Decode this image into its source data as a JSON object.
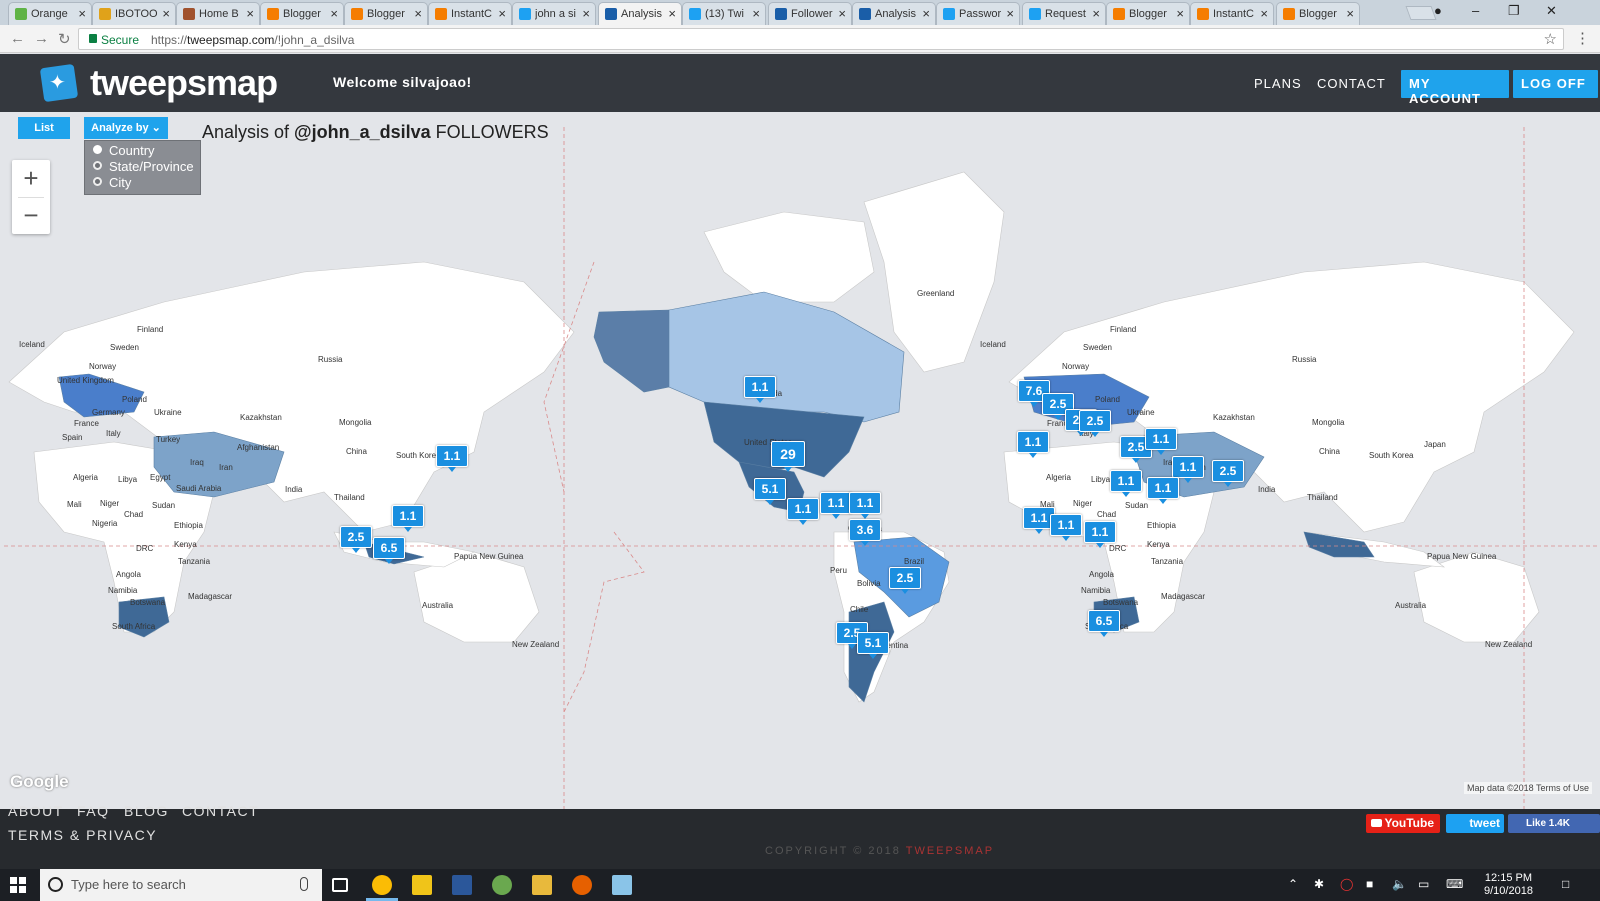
{
  "browser": {
    "tabs": [
      {
        "title": "Orange",
        "color": "#5fb346"
      },
      {
        "title": "IBOTOO",
        "color": "#e0a21a"
      },
      {
        "title": "Home B",
        "color": "#a0522d"
      },
      {
        "title": "Blogger",
        "color": "#f57d00"
      },
      {
        "title": "Blogger",
        "color": "#f57d00"
      },
      {
        "title": "InstantC",
        "color": "#f57d00"
      },
      {
        "title": "john a si",
        "color": "#1da1f2"
      },
      {
        "title": "Analysis",
        "color": "#1a5ea8",
        "active": true
      },
      {
        "title": "(13) Twi",
        "color": "#1da1f2"
      },
      {
        "title": "Follower",
        "color": "#1a5ea8"
      },
      {
        "title": "Analysis",
        "color": "#1a5ea8"
      },
      {
        "title": "Passwor",
        "color": "#1da1f2"
      },
      {
        "title": "Request",
        "color": "#1da1f2"
      },
      {
        "title": "Blogger",
        "color": "#f57d00"
      },
      {
        "title": "InstantC",
        "color": "#f57d00"
      },
      {
        "title": "Blogger",
        "color": "#f57d00"
      }
    ],
    "secure_label": "Secure",
    "url_scheme": "https://",
    "url_host": "tweepsmap.com",
    "url_path": "/!john_a_dsilva"
  },
  "site": {
    "logo_text": "tweepsmap",
    "welcome": "Welcome silvajoao!",
    "nav": {
      "plans": "PLANS",
      "contact": "CONTACT",
      "my_account": "MY ACCOUNT",
      "log_off": "LOG OFF"
    }
  },
  "controls": {
    "list_label": "List",
    "analyze_label": "Analyze by",
    "options": [
      "Country",
      "State/Province",
      "City"
    ],
    "selected": "Country",
    "title_prefix": "Analysis of ",
    "title_handle": "@john_a_dsilva",
    "title_suffix": " FOLLOWERS"
  },
  "map": {
    "google_label": "Google",
    "attribution": "Map data ©2018   Terms of Use",
    "place_labels": [
      "Iceland",
      "Finland",
      "Sweden",
      "Norway",
      "Russia",
      "United Kingdom",
      "Poland",
      "Germany",
      "Ukraine",
      "Kazakhstan",
      "France",
      "Italy",
      "Spain",
      "Mongolia",
      "Turkey",
      "Afghanistan",
      "China",
      "South Korea",
      "Iran",
      "Iraq",
      "Algeria",
      "Libya",
      "Egypt",
      "Saudi Arabia",
      "India",
      "Mali",
      "Niger",
      "Sudan",
      "Chad",
      "Thailand",
      "Nigeria",
      "Ethiopia",
      "DRC",
      "Kenya",
      "Tanzania",
      "Angola",
      "Namibia",
      "Madagascar",
      "Botswana",
      "South Africa",
      "Papua New Guinea",
      "Australia",
      "New Zealand",
      "Greenland",
      "Canada",
      "United States",
      "Colombia",
      "Peru",
      "Bolivia",
      "Chile",
      "Argentina",
      "Brazil",
      "Japan"
    ],
    "markers": [
      {
        "value": "1.1",
        "region": "Canada"
      },
      {
        "value": "29",
        "region": "United States"
      },
      {
        "value": "5.1",
        "region": "Mexico"
      },
      {
        "value": "1.1",
        "region": "Central America"
      },
      {
        "value": "1.1",
        "region": "Caribbean"
      },
      {
        "value": "1.1",
        "region": "Venezuela"
      },
      {
        "value": "3.6",
        "region": "Colombia"
      },
      {
        "value": "2.5",
        "region": "Brazil"
      },
      {
        "value": "2.5",
        "region": "Chile"
      },
      {
        "value": "5.1",
        "region": "Argentina"
      },
      {
        "value": "7.6",
        "region": "United Kingdom"
      },
      {
        "value": "2.5",
        "region": "Germany"
      },
      {
        "value": "2.5",
        "region": "Poland"
      },
      {
        "value": "2.5",
        "region": "Italy"
      },
      {
        "value": "1.1",
        "region": "Spain"
      },
      {
        "value": "2.5",
        "region": "Turkey"
      },
      {
        "value": "1.1",
        "region": "Armenia"
      },
      {
        "value": "1.1",
        "region": "Iran"
      },
      {
        "value": "1.1",
        "region": "Egypt"
      },
      {
        "value": "1.1",
        "region": "Saudi Arabia"
      },
      {
        "value": "2.5",
        "region": "Pakistan"
      },
      {
        "value": "1.1",
        "region": "Mali"
      },
      {
        "value": "1.1",
        "region": "Nigeria"
      },
      {
        "value": "1.1",
        "region": "Ethiopia"
      },
      {
        "value": "6.5",
        "region": "South Africa"
      },
      {
        "value": "1.1",
        "region": "Japan"
      },
      {
        "value": "1.1",
        "region": "Philippines"
      },
      {
        "value": "2.5",
        "region": "Malaysia"
      },
      {
        "value": "6.5",
        "region": "Indonesia"
      }
    ]
  },
  "footer": {
    "links": [
      "ABOUT",
      "FAQ",
      "BLOG",
      "CONTACT"
    ],
    "terms": "TERMS & PRIVACY",
    "copyright": "COPYRIGHT © 2018 ",
    "brand": "TWEEPSMAP",
    "youtube": "YouTube",
    "tweet": "tweet",
    "like": "Like 1.4K"
  },
  "taskbar": {
    "search_placeholder": "Type here to search",
    "time": "12:15 PM",
    "date": "9/10/2018"
  }
}
